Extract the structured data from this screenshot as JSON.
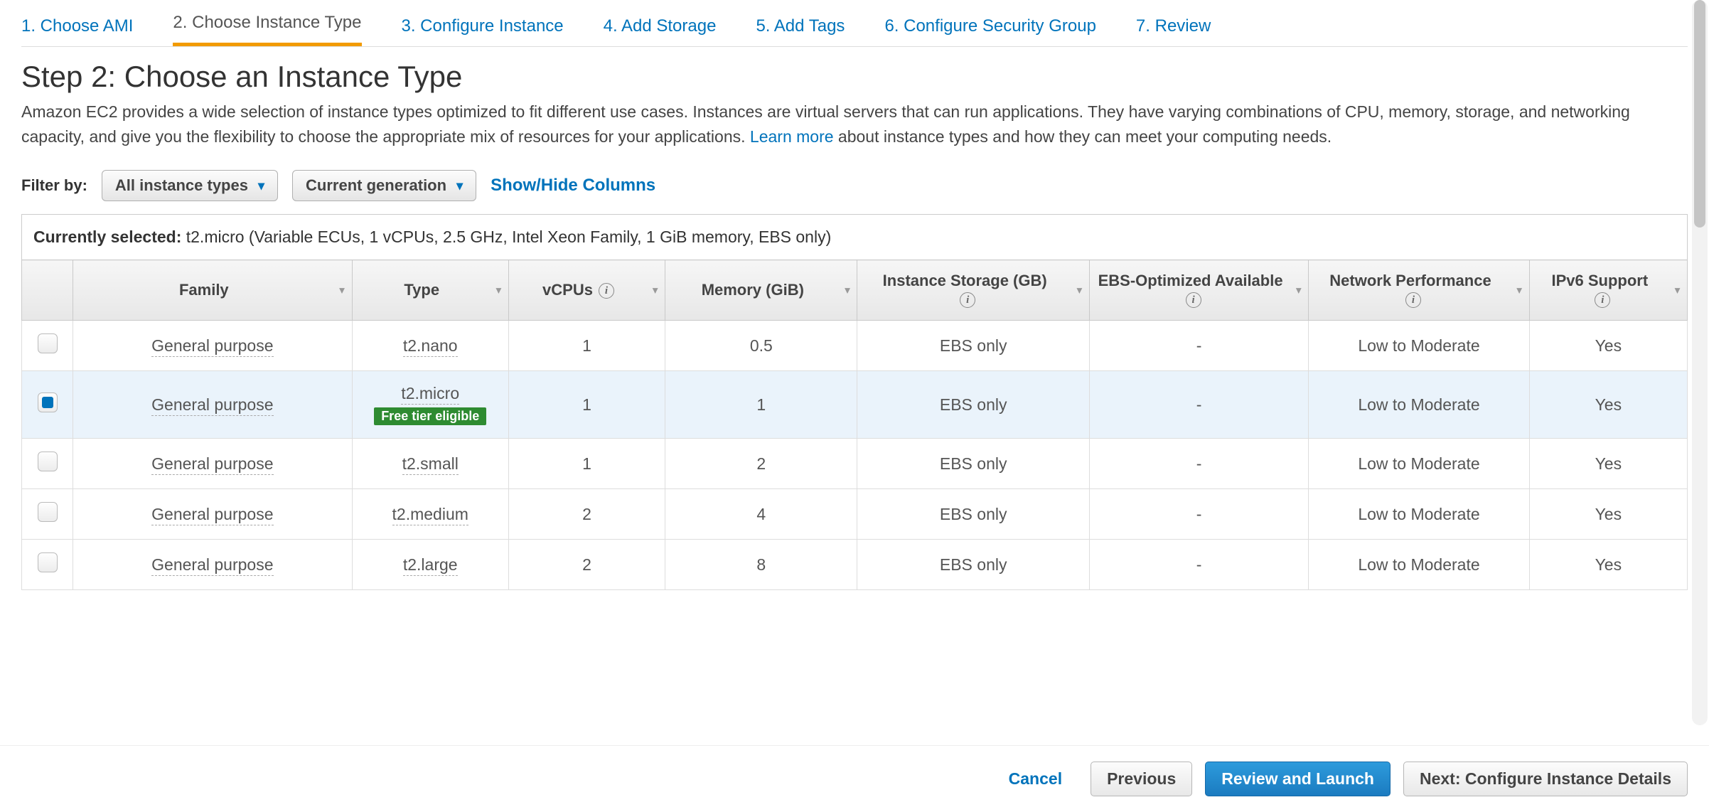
{
  "steps": [
    {
      "label": "1. Choose AMI",
      "active": false
    },
    {
      "label": "2. Choose Instance Type",
      "active": true
    },
    {
      "label": "3. Configure Instance",
      "active": false
    },
    {
      "label": "4. Add Storage",
      "active": false
    },
    {
      "label": "5. Add Tags",
      "active": false
    },
    {
      "label": "6. Configure Security Group",
      "active": false
    },
    {
      "label": "7. Review",
      "active": false
    }
  ],
  "header": {
    "title": "Step 2: Choose an Instance Type",
    "desc_a": "Amazon EC2 provides a wide selection of instance types optimized to fit different use cases. Instances are virtual servers that can run applications. They have varying combinations of CPU, memory, storage, and networking capacity, and give you the flexibility to choose the appropriate mix of resources for your applications. ",
    "learn_more": "Learn more",
    "desc_b": " about instance types and how they can meet your computing needs."
  },
  "filter": {
    "label": "Filter by:",
    "all_types": "All instance types",
    "generation": "Current generation",
    "show_hide": "Show/Hide Columns"
  },
  "current_selected": {
    "label": "Currently selected:",
    "value": " t2.micro (Variable ECUs, 1 vCPUs, 2.5 GHz, Intel Xeon Family, 1 GiB memory, EBS only)"
  },
  "columns": {
    "family": "Family",
    "type": "Type",
    "vcpus": "vCPUs",
    "memory": "Memory (GiB)",
    "storage": "Instance Storage (GB)",
    "ebs": "EBS-Optimized Available",
    "network": "Network Performance",
    "ipv6": "IPv6 Support"
  },
  "free_tier_badge": "Free tier eligible",
  "rows": [
    {
      "selected": false,
      "family": "General purpose",
      "type": "t2.nano",
      "free": false,
      "vcpus": "1",
      "memory": "0.5",
      "storage": "EBS only",
      "ebs": "-",
      "network": "Low to Moderate",
      "ipv6": "Yes"
    },
    {
      "selected": true,
      "family": "General purpose",
      "type": "t2.micro",
      "free": true,
      "vcpus": "1",
      "memory": "1",
      "storage": "EBS only",
      "ebs": "-",
      "network": "Low to Moderate",
      "ipv6": "Yes"
    },
    {
      "selected": false,
      "family": "General purpose",
      "type": "t2.small",
      "free": false,
      "vcpus": "1",
      "memory": "2",
      "storage": "EBS only",
      "ebs": "-",
      "network": "Low to Moderate",
      "ipv6": "Yes"
    },
    {
      "selected": false,
      "family": "General purpose",
      "type": "t2.medium",
      "free": false,
      "vcpus": "2",
      "memory": "4",
      "storage": "EBS only",
      "ebs": "-",
      "network": "Low to Moderate",
      "ipv6": "Yes"
    },
    {
      "selected": false,
      "family": "General purpose",
      "type": "t2.large",
      "free": false,
      "vcpus": "2",
      "memory": "8",
      "storage": "EBS only",
      "ebs": "-",
      "network": "Low to Moderate",
      "ipv6": "Yes"
    }
  ],
  "footer": {
    "cancel": "Cancel",
    "previous": "Previous",
    "review": "Review and Launch",
    "next": "Next: Configure Instance Details"
  }
}
